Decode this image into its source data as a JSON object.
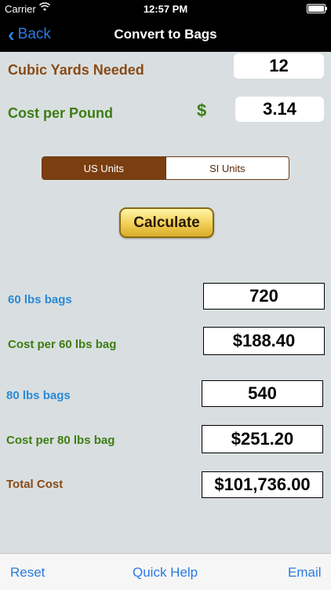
{
  "status": {
    "carrier": "Carrier",
    "time": "12:57 PM"
  },
  "nav": {
    "back_label": "Back",
    "title": "Convert to Bags"
  },
  "form": {
    "cubic_yards_label": "Cubic Yards Needed",
    "cubic_yards_value": "12",
    "cost_per_pound_label": "Cost per Pound",
    "currency_symbol": "$",
    "cost_per_pound_value": "3.14"
  },
  "units": {
    "us": "US Units",
    "si": "SI Units",
    "selected": "US Units"
  },
  "calculate_label": "Calculate",
  "results": {
    "bags60_label": "60 lbs bags",
    "bags60_value": "720",
    "cost60_label": "Cost per 60 lbs bag",
    "cost60_value": "$188.40",
    "bags80_label": "80 lbs bags",
    "bags80_value": "540",
    "cost80_label": "Cost per 80 lbs bag",
    "cost80_value": "$251.20",
    "total_label": "Total Cost",
    "total_value": "$101,736.00"
  },
  "toolbar": {
    "reset": "Reset",
    "help": "Quick Help",
    "email": "Email"
  },
  "colors": {
    "label_brown": "#8a4a17",
    "label_green": "#3d7d14",
    "label_blue": "#2a8ad6",
    "ios_blue": "#2a7be0",
    "segment_active": "#7a3e10"
  }
}
